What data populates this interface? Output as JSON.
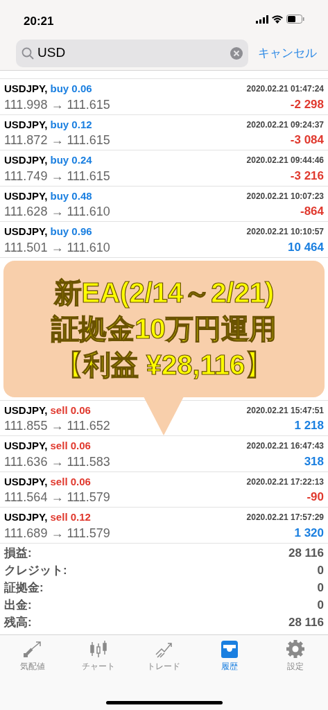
{
  "status_bar": {
    "time": "20:21"
  },
  "search": {
    "value": "USD",
    "cancel": "キャンセル"
  },
  "trades": [
    {
      "symbol": "USDJPY,",
      "order": "buy 0.06",
      "kind": "buy",
      "time": "2020.02.21 01:47:24",
      "prices": "111.998 → 111.615",
      "profit": "-2 298",
      "color": "#e0392e"
    },
    {
      "symbol": "USDJPY,",
      "order": "buy 0.12",
      "kind": "buy",
      "time": "2020.02.21 09:24:37",
      "prices": "111.872 → 111.615",
      "profit": "-3 084",
      "color": "#e0392e"
    },
    {
      "symbol": "USDJPY,",
      "order": "buy 0.24",
      "kind": "buy",
      "time": "2020.02.21 09:44:46",
      "prices": "111.749 → 111.615",
      "profit": "-3 216",
      "color": "#e0392e"
    },
    {
      "symbol": "USDJPY,",
      "order": "buy 0.48",
      "kind": "buy",
      "time": "2020.02.21 10:07:23",
      "prices": "111.628 → 111.610",
      "profit": "-864",
      "color": "#e0392e"
    },
    {
      "symbol": "USDJPY,",
      "order": "buy 0.96",
      "kind": "buy",
      "time": "2020.02.21 10:10:57",
      "prices": "111.501 → 111.610",
      "profit": "10 464",
      "color": "#1a7fe0"
    }
  ],
  "banner": {
    "lines": [
      "新EA(2/14～2/21)",
      "証拠金10万円運用",
      "【利益 ¥28,116】"
    ]
  },
  "trades_after": [
    {
      "symbol": "USDJPY,",
      "order": "sell 0.06",
      "kind": "sell",
      "time": "2020.02.21 15:47:51",
      "prices": "111.855 → 111.652",
      "profit": "1 218",
      "color": "#1a7fe0"
    },
    {
      "symbol": "USDJPY,",
      "order": "sell 0.06",
      "kind": "sell",
      "time": "2020.02.21 16:47:43",
      "prices": "111.636 → 111.583",
      "profit": "318",
      "color": "#1a7fe0"
    },
    {
      "symbol": "USDJPY,",
      "order": "sell 0.06",
      "kind": "sell",
      "time": "2020.02.21 17:22:13",
      "prices": "111.564 → 111.579",
      "profit": "-90",
      "color": "#e0392e"
    },
    {
      "symbol": "USDJPY,",
      "order": "sell 0.12",
      "kind": "sell",
      "time": "2020.02.21 17:57:29",
      "prices": "111.689 → 111.579",
      "profit": "1 320",
      "color": "#1a7fe0"
    }
  ],
  "summary": [
    {
      "label": "損益:",
      "value": "28 116"
    },
    {
      "label": "クレジット:",
      "value": "0"
    },
    {
      "label": "証拠金:",
      "value": "0"
    },
    {
      "label": "出金:",
      "value": "0"
    },
    {
      "label": "残高:",
      "value": "28 116"
    }
  ],
  "tabs": [
    {
      "label": "気配値",
      "selected": false
    },
    {
      "label": "チャート",
      "selected": false
    },
    {
      "label": "トレード",
      "selected": false
    },
    {
      "label": "履歴",
      "selected": true
    },
    {
      "label": "設定",
      "selected": false
    }
  ]
}
